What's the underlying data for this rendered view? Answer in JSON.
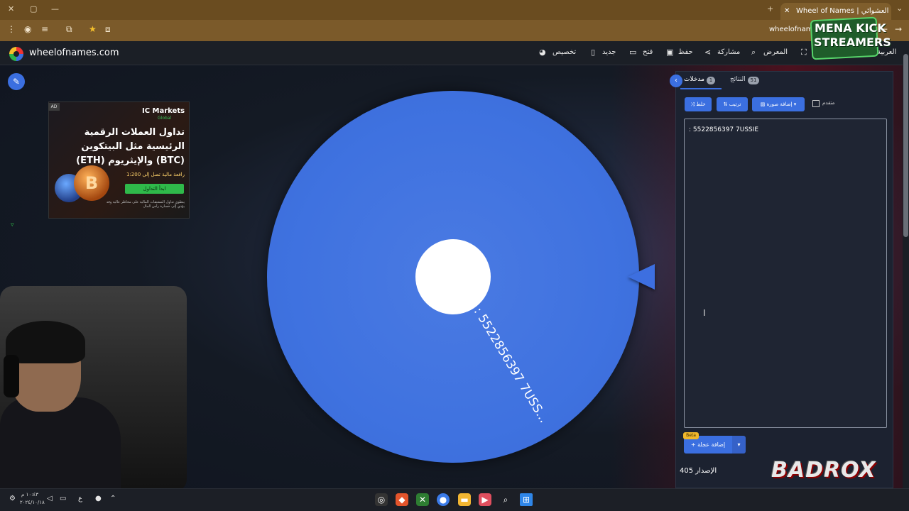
{
  "browser": {
    "tab_title": "Wheel of Names | سم العشوائي",
    "url": "wheelofnames",
    "icons": [
      "menu-dots-icon",
      "extension-icon",
      "media-icon",
      "reload-icon",
      "star-icon",
      "screenshot-icon",
      "new-tab-icon",
      "close-icon",
      "forward-icon"
    ]
  },
  "site": {
    "name": "wheelofnames.com",
    "menu": {
      "customize": "تخصيص",
      "new": "جديد",
      "open": "فتح",
      "save": "حفظ",
      "share": "مشاركة",
      "gallery": "المعرض",
      "language": "العربية"
    }
  },
  "ad": {
    "tag": "AD",
    "brand": "IC Markets",
    "brand_sub": "Global",
    "headline": "تداول العملات الرقمية الرئيسية مثل البيتكوين (BTC) والإيثريوم (ETH)",
    "sub": "رافعة مالية تصل إلى 1:200",
    "cta": "ابدأ التداول",
    "fine": "ينطوي تداول المشتقات المالية على مخاطر عالية وقد يؤدي إلى خسارة رأس المال",
    "coin_letter": "B"
  },
  "wheel": {
    "label": ": 5522856397 7USS...",
    "color": "#3f72e0"
  },
  "panel": {
    "tab_entries": "مدخلات",
    "entries_count": "1",
    "tab_results": "النتائج",
    "results_count": "51",
    "shuffle": "خلط",
    "sort": "ترتيب",
    "add_image": "إضافة صورة",
    "advanced": "متقدم",
    "entries_text": ": 5522856397 7USSIE",
    "beta": "Beta",
    "add_wheel": "إضافة عجلة",
    "version": "الإصدار 405"
  },
  "overlays": {
    "mena_line1": "MENA KICK",
    "mena_line2": "STREAMERS",
    "badrox": "BADROX"
  },
  "taskbar": {
    "clock_time": "١٠:٤٣ م",
    "clock_date": "٢٠٢٤/١٠/١٨",
    "lang": "ع"
  }
}
